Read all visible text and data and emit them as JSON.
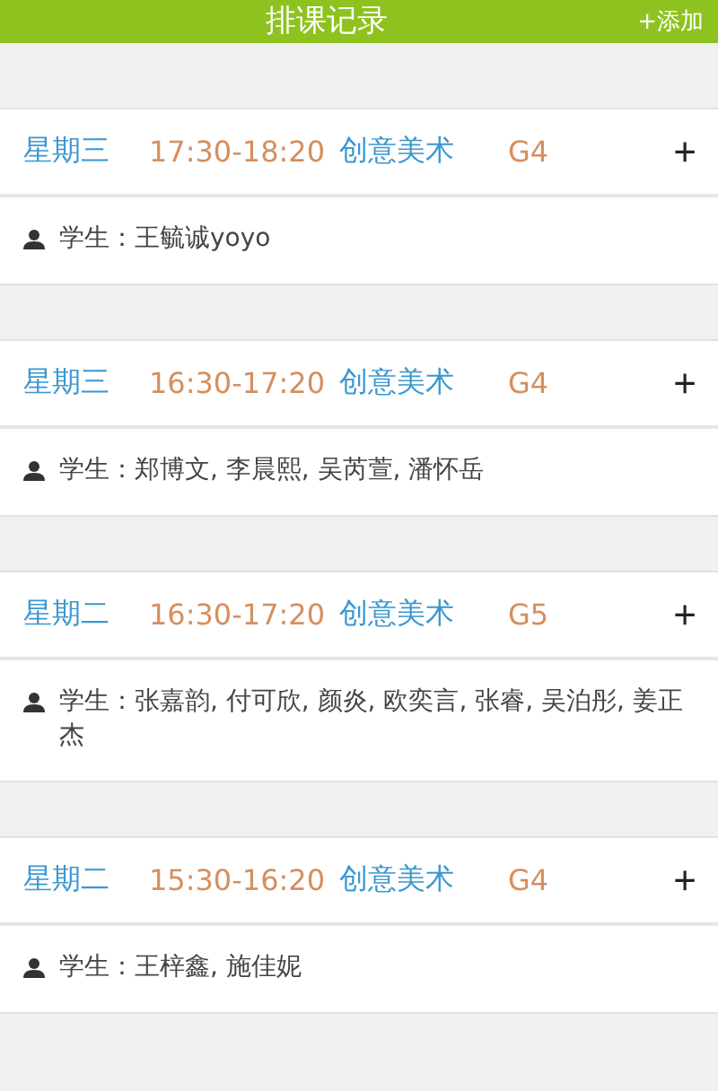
{
  "header": {
    "title": "排课记录",
    "action": "+添加"
  },
  "records": [
    {
      "day": "星期三",
      "time": "17:30-18:20",
      "course": "创意美术",
      "grade": "G4",
      "expand": "+",
      "students": "学生：王毓诚yoyo"
    },
    {
      "day": "星期三",
      "time": "16:30-17:20",
      "course": "创意美术",
      "grade": "G4",
      "expand": "+",
      "students": "学生：郑博文, 李晨熙, 吴芮萱, 潘怀岳"
    },
    {
      "day": "星期二",
      "time": "16:30-17:20",
      "course": "创意美术",
      "grade": "G5",
      "expand": "+",
      "students": "学生：张嘉韵, 付可欣, 颜炎, 欧奕言, 张睿, 吴泊彤, 姜正杰"
    },
    {
      "day": "星期二",
      "time": "15:30-16:20",
      "course": "创意美术",
      "grade": "G4",
      "expand": "+",
      "students": "学生：王梓鑫, 施佳妮"
    }
  ]
}
